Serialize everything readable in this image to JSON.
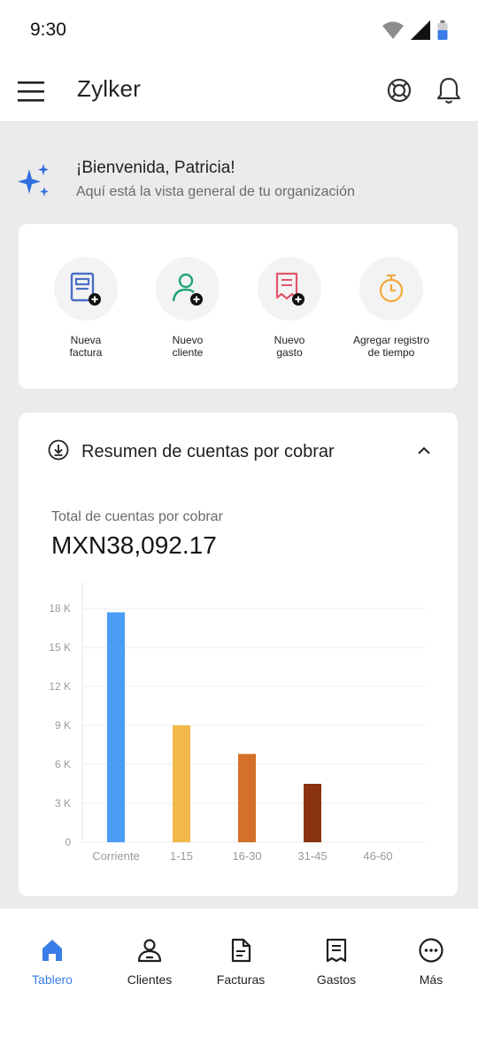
{
  "status_bar": {
    "time": "9:30"
  },
  "app_bar": {
    "title": "Zylker"
  },
  "welcome": {
    "greeting": "¡Bienvenida, Patricia!",
    "subtitle": "Aquí está la vista general de tu organización"
  },
  "quick_actions": [
    {
      "line1": "Nueva",
      "line2": "factura",
      "icon": "new-invoice-icon"
    },
    {
      "line1": "Nuevo",
      "line2": "cliente",
      "icon": "new-customer-icon"
    },
    {
      "line1": "Nuevo",
      "line2": "gasto",
      "icon": "new-expense-icon"
    },
    {
      "line1": "Agregar registro",
      "line2": "de tiempo",
      "icon": "stopwatch-icon"
    }
  ],
  "receivables": {
    "title": "Resumen de cuentas por cobrar",
    "total_label": "Total de cuentas por cobrar",
    "total_amount": "MXN38,092.17"
  },
  "chart_data": {
    "type": "bar",
    "title": "",
    "xlabel": "",
    "ylabel": "",
    "categories": [
      "Corriente",
      "1-15",
      "16-30",
      "31-45",
      "46-60"
    ],
    "values": [
      17700,
      9000,
      6800,
      4500,
      0
    ],
    "colors": [
      "#4a9cf5",
      "#f2b84b",
      "#d4702a",
      "#8a3311",
      "#cccccc"
    ],
    "ylim": [
      0,
      18000
    ],
    "yticks": [
      0,
      3000,
      6000,
      9000,
      12000,
      15000,
      18000
    ],
    "ytick_labels": [
      "0",
      "3 K",
      "6 K",
      "9 K",
      "12 K",
      "15 K",
      "18 K"
    ],
    "grid": true,
    "legend": "none"
  },
  "tab_bar": {
    "items": [
      {
        "label": "Tablero",
        "active": true,
        "icon": "home-icon"
      },
      {
        "label": "Clientes",
        "active": false,
        "icon": "customers-icon"
      },
      {
        "label": "Facturas",
        "active": false,
        "icon": "invoices-icon"
      },
      {
        "label": "Gastos",
        "active": false,
        "icon": "expenses-icon"
      },
      {
        "label": "Más",
        "active": false,
        "icon": "more-icon"
      }
    ]
  },
  "colors": {
    "accent": "#3a7de8",
    "background": "#ebebeb",
    "card": "#ffffff"
  }
}
